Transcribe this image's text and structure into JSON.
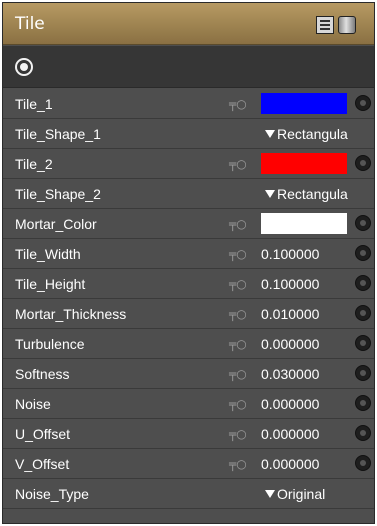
{
  "panel": {
    "title": "Tile",
    "colors": {
      "titlebar": "#a08552",
      "background": "#4e4e4e",
      "target_row": "#363636"
    },
    "icons": {
      "menu": "document-list-icon",
      "cylinder": "cylinder-icon",
      "target": "target-icon",
      "key": "key-icon",
      "connector": "connector-icon"
    }
  },
  "properties": [
    {
      "label": "Tile_1",
      "type": "color",
      "color": "#0000ff"
    },
    {
      "label": "Tile_Shape_1",
      "type": "dropdown",
      "value": "Rectangula"
    },
    {
      "label": "Tile_2",
      "type": "color",
      "color": "#ff0000"
    },
    {
      "label": "Tile_Shape_2",
      "type": "dropdown",
      "value": "Rectangula"
    },
    {
      "label": "Mortar_Color",
      "type": "color",
      "color": "#ffffff"
    },
    {
      "label": "Tile_Width",
      "type": "number",
      "value": "0.100000"
    },
    {
      "label": "Tile_Height",
      "type": "number",
      "value": "0.100000"
    },
    {
      "label": "Mortar_Thickness",
      "type": "number",
      "value": "0.010000"
    },
    {
      "label": "Turbulence",
      "type": "number",
      "value": "0.000000"
    },
    {
      "label": "Softness",
      "type": "number",
      "value": "0.030000"
    },
    {
      "label": "Noise",
      "type": "number",
      "value": "0.000000"
    },
    {
      "label": "U_Offset",
      "type": "number",
      "value": "0.000000"
    },
    {
      "label": "V_Offset",
      "type": "number",
      "value": "0.000000"
    },
    {
      "label": "Noise_Type",
      "type": "dropdown",
      "value": "Original"
    }
  ]
}
